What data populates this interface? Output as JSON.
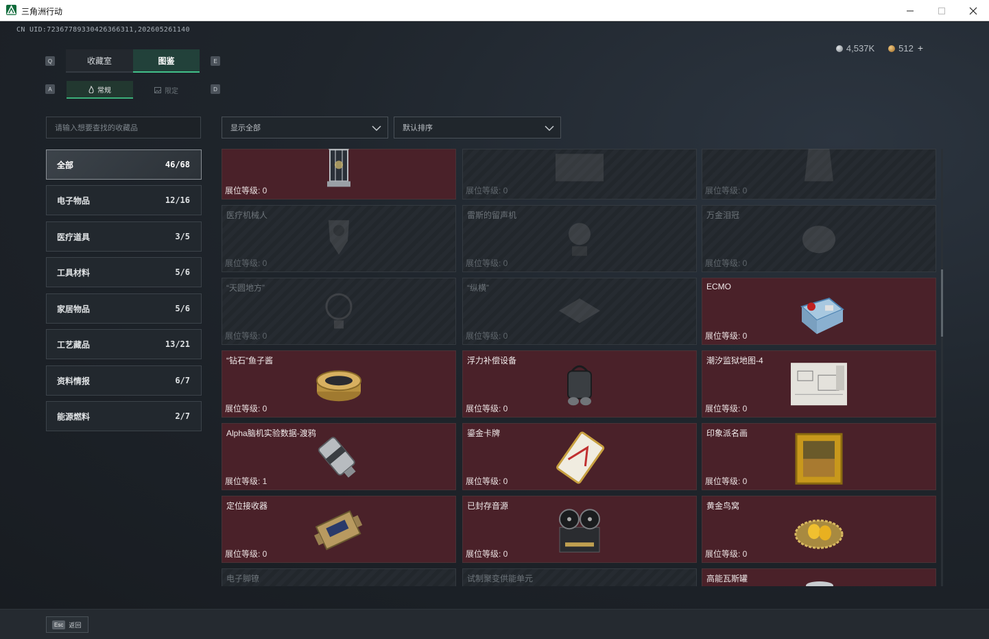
{
  "window": {
    "title": "三角洲行动"
  },
  "header": {
    "uid": "CN UID:72367789330426366311,202605261140",
    "keys": {
      "q": "Q",
      "e": "E",
      "a": "A",
      "d": "D"
    },
    "tabs": [
      {
        "label": "收藏室"
      },
      {
        "label": "图鉴"
      }
    ],
    "subtabs": [
      {
        "label": "常规"
      },
      {
        "label": "限定"
      }
    ],
    "currency": {
      "silver": "4,537K",
      "gold": "512",
      "plus": "+"
    }
  },
  "search": {
    "placeholder": "请输入想要查找的收藏品"
  },
  "filters": {
    "show": "显示全部",
    "sort": "默认排序"
  },
  "categories": [
    {
      "label": "全部",
      "count": "46/68"
    },
    {
      "label": "电子物品",
      "count": "12/16"
    },
    {
      "label": "医疗道具",
      "count": "3/5"
    },
    {
      "label": "工具材料",
      "count": "5/6"
    },
    {
      "label": "家居物品",
      "count": "5/6"
    },
    {
      "label": "工艺藏品",
      "count": "13/21"
    },
    {
      "label": "资料情报",
      "count": "6/7"
    },
    {
      "label": "能源燃料",
      "count": "2/7"
    }
  ],
  "items": [
    {
      "name": "",
      "level": "展位等级: 0",
      "icon": "lantern-icon",
      "locked": false
    },
    {
      "name": "",
      "level": "展位等级: 0",
      "icon": "crate-icon",
      "locked": true
    },
    {
      "name": "",
      "level": "展位等级: 0",
      "icon": "vase-icon",
      "locked": true
    },
    {
      "name": "医疗机械人",
      "level": "展位等级: 0",
      "icon": "robot-icon",
      "locked": true
    },
    {
      "name": "雷斯的留声机",
      "level": "展位等级: 0",
      "icon": "phonograph-icon",
      "locked": true
    },
    {
      "name": "万金泪冠",
      "level": "展位等级: 0",
      "icon": "crown-icon",
      "locked": true
    },
    {
      "name": "“天圆地方”",
      "level": "展位等级: 0",
      "icon": "globe-icon",
      "locked": true
    },
    {
      "name": "“纵横”",
      "level": "展位等级: 0",
      "icon": "chessboard-icon",
      "locked": true
    },
    {
      "name": "ECMO",
      "level": "展位等级: 0",
      "icon": "ecmo-machine-icon",
      "locked": false
    },
    {
      "name": "“钻石”鱼子酱",
      "level": "展位等级: 0",
      "icon": "caviar-tin-icon",
      "locked": false
    },
    {
      "name": "浮力补偿设备",
      "level": "展位等级: 0",
      "icon": "buoyancy-device-icon",
      "locked": false
    },
    {
      "name": "潮汐监狱地图-4",
      "level": "展位等级: 0",
      "icon": "map-icon",
      "locked": false
    },
    {
      "name": "Alpha脑机实验数据-渡鸦",
      "level": "展位等级: 1",
      "icon": "data-cylinder-icon",
      "locked": false
    },
    {
      "name": "鎏金卡牌",
      "level": "展位等级: 0",
      "icon": "gold-card-icon",
      "locked": false
    },
    {
      "name": "印象派名画",
      "level": "展位等级: 0",
      "icon": "painting-icon",
      "locked": false
    },
    {
      "name": "定位接收器",
      "level": "展位等级: 0",
      "icon": "receiver-icon",
      "locked": false
    },
    {
      "name": "已封存音源",
      "level": "展位等级: 0",
      "icon": "tape-recorder-icon",
      "locked": false
    },
    {
      "name": "黄金鸟窝",
      "level": "展位等级: 0",
      "icon": "golden-nest-icon",
      "locked": false
    },
    {
      "name": "电子脚镣",
      "level": "",
      "icon": "ankle-monitor-icon",
      "locked": true
    },
    {
      "name": "试制聚变供能单元",
      "level": "",
      "icon": "fusion-unit-icon",
      "locked": true
    },
    {
      "name": "高能瓦斯罐",
      "level": "",
      "icon": "gas-canister-icon",
      "locked": false
    }
  ],
  "footer": {
    "esc": "Esc",
    "back": "返回"
  }
}
